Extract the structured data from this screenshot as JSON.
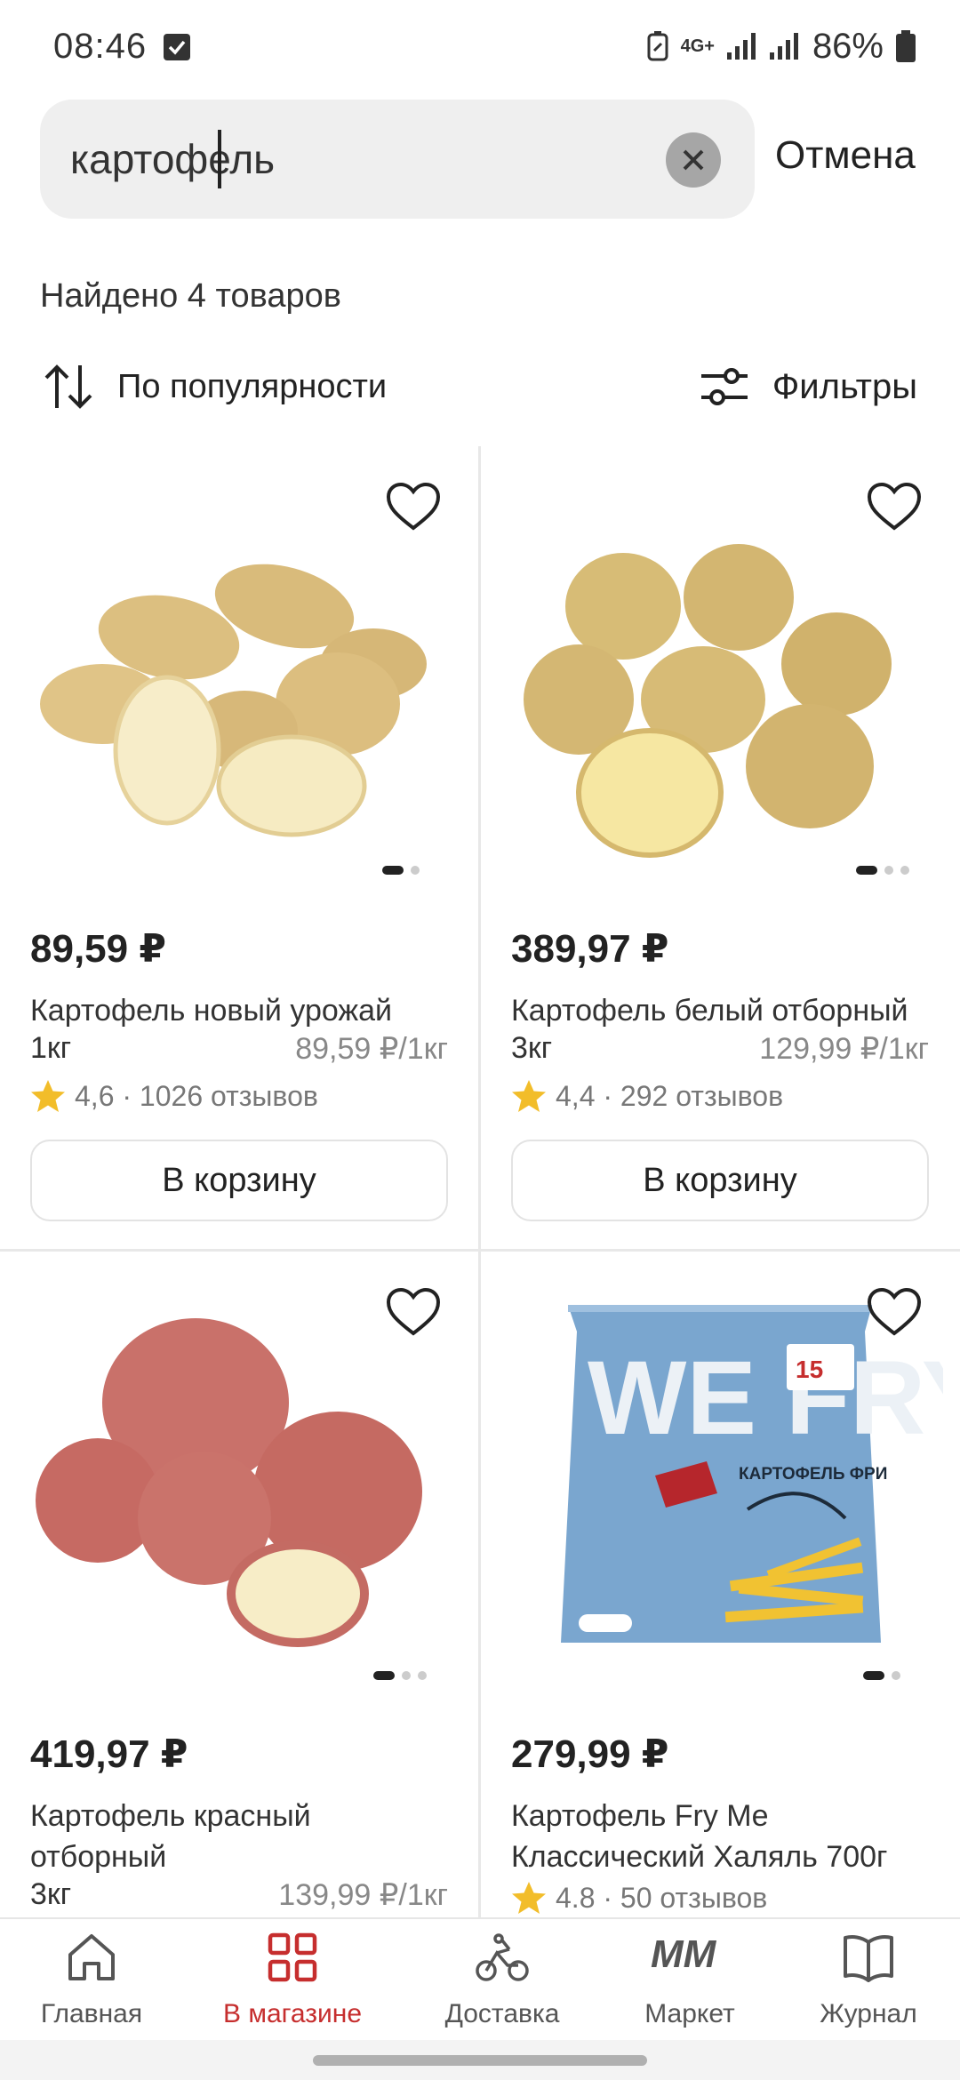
{
  "status_bar": {
    "time": "08:46",
    "network": "4G+",
    "battery": "86%"
  },
  "search": {
    "query": "картофель",
    "cancel_label": "Отмена"
  },
  "result_count": "Найдено 4 товаров",
  "sort_label": "По популярности",
  "filters_label": "Фильтры",
  "colors": {
    "accent": "#c62e2e",
    "star": "#f2bd2a"
  },
  "products": [
    {
      "price": "89,59 ₽",
      "title": "Картофель новый урожай",
      "weight": "1кг",
      "unit_price": "89,59 ₽/1кг",
      "rating": "4,6 · 1026 отзывов",
      "cart_label": "В корзину"
    },
    {
      "price": "389,97 ₽",
      "title": "Картофель белый отборный",
      "weight": "3кг",
      "unit_price": "129,99 ₽/1кг",
      "rating": "4,4 · 292 отзывов",
      "cart_label": "В корзину"
    },
    {
      "price": "419,97 ₽",
      "title": "Картофель красный отборный",
      "weight": "3кг",
      "unit_price": "139,99 ₽/1кг"
    },
    {
      "price": "279,99 ₽",
      "title": "Картофель Fry Me Классический Халяль 700г",
      "rating": "4.8 · 50 отзывов",
      "package_brand": "WE FRY",
      "package_label": "КАРТОФЕЛЬ ФРИ"
    }
  ],
  "nav": [
    {
      "label": "Главная",
      "icon": "home-icon"
    },
    {
      "label": "В магазине",
      "icon": "store-grid-icon",
      "active": true
    },
    {
      "label": "Доставка",
      "icon": "bike-icon"
    },
    {
      "label": "Маркет",
      "icon": "mm-logo-icon"
    },
    {
      "label": "Журнал",
      "icon": "book-icon"
    }
  ]
}
